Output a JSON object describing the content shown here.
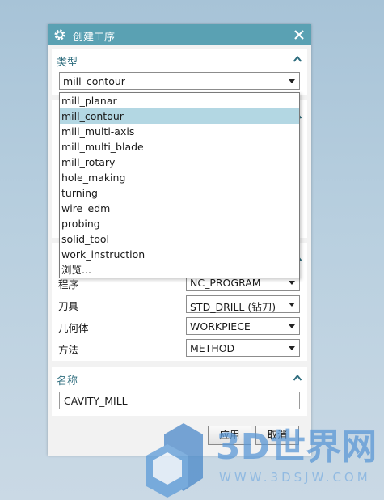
{
  "dialog": {
    "title": "创建工序",
    "type_section": {
      "heading": "类型",
      "selected": "mill_contour"
    },
    "type_options": [
      "mill_planar",
      "mill_contour",
      "mill_multi-axis",
      "mill_multi_blade",
      "mill_rotary",
      "hole_making",
      "turning",
      "wire_edm",
      "probing",
      "solid_tool",
      "work_instruction",
      "浏览..."
    ],
    "type_highlighted": "mill_contour",
    "location": {
      "rows": [
        {
          "label": "程序",
          "value": "NC_PROGRAM"
        },
        {
          "label": "刀具",
          "value": "STD_DRILL (钻刀)"
        },
        {
          "label": "几何体",
          "value": "WORKPIECE"
        },
        {
          "label": "方法",
          "value": "METHOD"
        }
      ]
    },
    "name_section": {
      "heading": "名称",
      "value": "CAVITY_MILL"
    },
    "buttons": {
      "apply": "应用",
      "cancel": "取消"
    }
  },
  "watermark": {
    "brand": "3D世界网",
    "url": "WWW.3DSJW.COM"
  },
  "colors": {
    "titlebar": "#5aa1b3",
    "heading": "#2e6d7e",
    "highlight": "#b3d7e3"
  }
}
